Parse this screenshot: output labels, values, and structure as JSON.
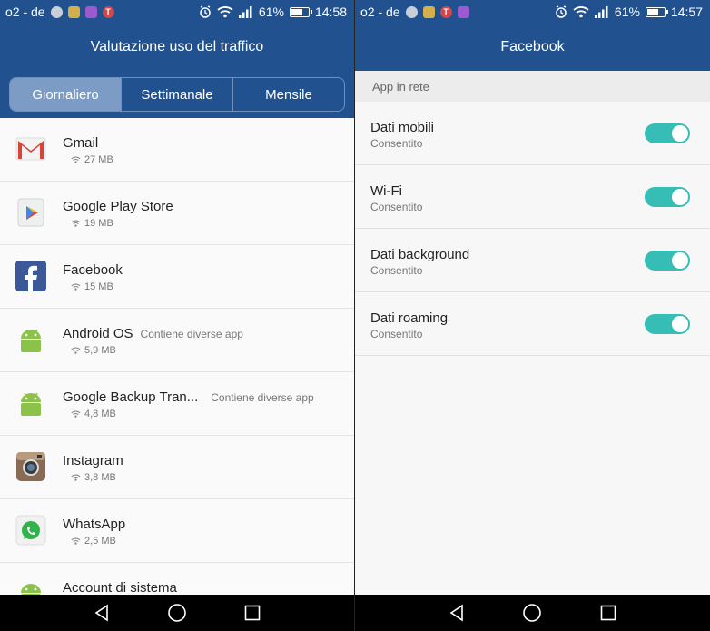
{
  "left": {
    "status": {
      "carrier": "o2 - de",
      "notif_t": "T",
      "battery": "61%",
      "time": "14:58",
      "battery_level": 0.61
    },
    "title": "Valutazione uso del traffico",
    "tabs": [
      {
        "label": "Giornaliero"
      },
      {
        "label": "Settimanale"
      },
      {
        "label": "Mensile"
      }
    ],
    "apps": [
      {
        "name": "Gmail",
        "note": "",
        "usage": "27 MB"
      },
      {
        "name": "Google Play Store",
        "note": "",
        "usage": "19 MB"
      },
      {
        "name": "Facebook",
        "note": "",
        "usage": "15 MB"
      },
      {
        "name": "Android OS",
        "note": "Contiene diverse app",
        "usage": "5,9 MB"
      },
      {
        "name": "Google Backup Tran...",
        "note": "Contiene diverse app",
        "usage": "4,8 MB"
      },
      {
        "name": "Instagram",
        "note": "",
        "usage": "3,8 MB"
      },
      {
        "name": "WhatsApp",
        "note": "",
        "usage": "2,5 MB"
      },
      {
        "name": "Account di sistema",
        "note": "",
        "usage": ""
      }
    ]
  },
  "right": {
    "status": {
      "carrier": "o2 - de",
      "notif_t": "T",
      "battery": "61%",
      "time": "14:57",
      "battery_level": 0.61
    },
    "title": "Facebook",
    "section": "App in rete",
    "settings": [
      {
        "title": "Dati mobili",
        "subtitle": "Consentito",
        "on": true
      },
      {
        "title": "Wi-Fi",
        "subtitle": "Consentito",
        "on": true
      },
      {
        "title": "Dati background",
        "subtitle": "Consentito",
        "on": true
      },
      {
        "title": "Dati roaming",
        "subtitle": "Consentito",
        "on": true
      }
    ]
  },
  "colors": {
    "header": "#21518f",
    "active_tab": "#7c9cc6",
    "toggle_on": "#35bdb6"
  }
}
